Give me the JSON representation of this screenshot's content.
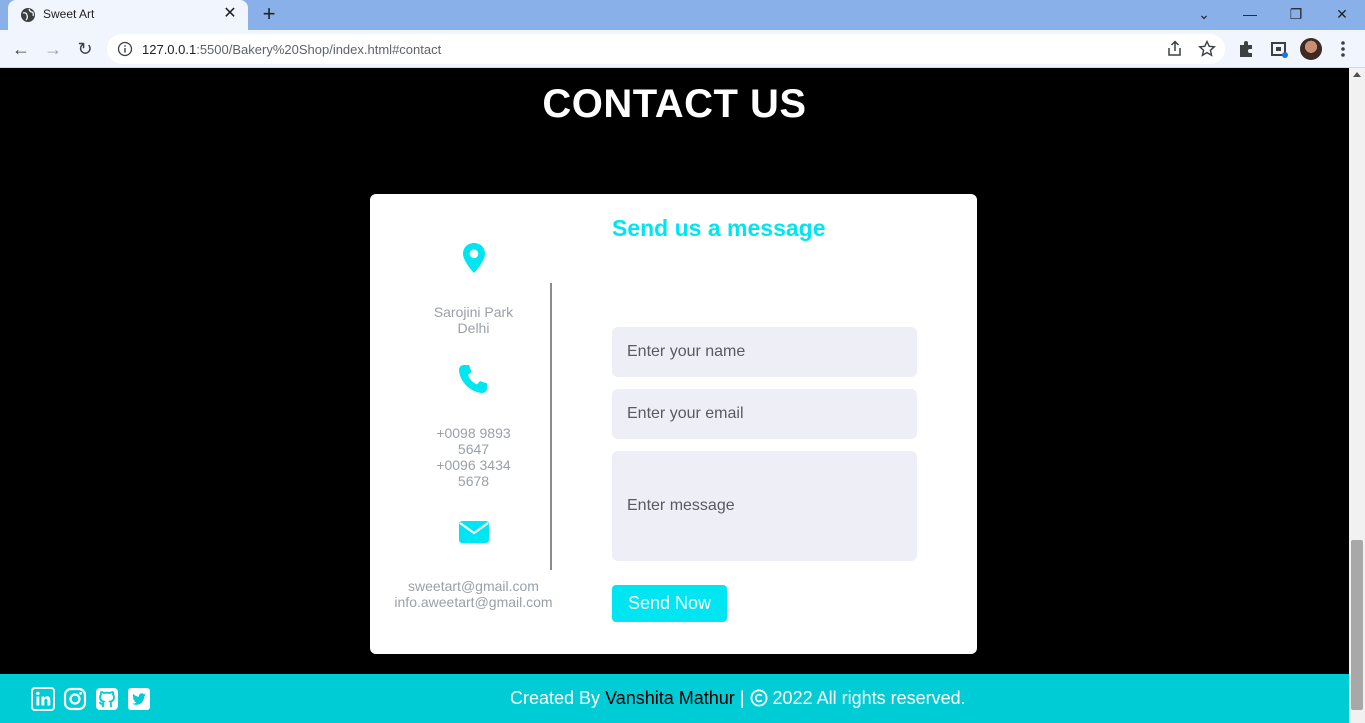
{
  "browser": {
    "tab_title": "Sweet Art",
    "tab_close": "✕",
    "new_tab": "+",
    "url_host": "127.0.0.1",
    "url_rest": ":5500/Bakery%20Shop/index.html#contact",
    "window_controls": {
      "tab_search": "⌄",
      "minimize": "—",
      "restore": "❐",
      "close": "✕"
    },
    "nav": {
      "back": "←",
      "forward": "→",
      "reload": "↻"
    }
  },
  "page": {
    "heading": "CONTACT US",
    "contact": {
      "address_line1": "Sarojini Park",
      "address_line2": "Delhi",
      "phone_line1": "+0098 9893",
      "phone_line2": "5647",
      "phone_line3": "+0096 3434",
      "phone_line4": "5678",
      "email_line1": "sweetart@gmail.com",
      "email_line2": "info.aweetart@gmail.com"
    },
    "form": {
      "title": "Send us a message",
      "name_placeholder": "Enter your name",
      "email_placeholder": "Enter your email",
      "message_placeholder": "Enter message",
      "submit_label": "Send Now"
    },
    "footer": {
      "created_by": "Created By",
      "author": "Vanshita Mathur",
      "separator": "|",
      "rights": "2022 All rights reserved.",
      "social_icons": [
        "linkedin-icon",
        "instagram-icon",
        "github-icon",
        "twitter-icon"
      ]
    }
  },
  "colors": {
    "accent": "#00e5f2",
    "footer_bg": "#00ccd6",
    "page_bg": "#000000",
    "card_bg": "#ffffff",
    "field_bg": "#eeeef6"
  }
}
